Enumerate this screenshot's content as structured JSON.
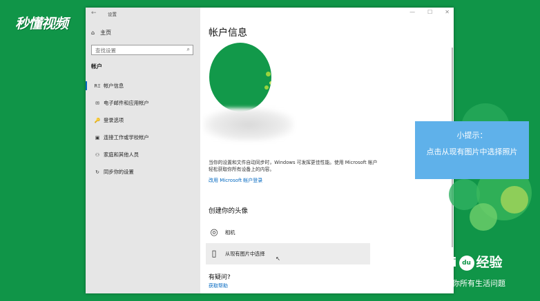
{
  "watermark": {
    "logo_text": "秒懂视频"
  },
  "window": {
    "title": "设置",
    "back_glyph": "←",
    "controls": [
      "—",
      "☐",
      "✕"
    ]
  },
  "sidebar": {
    "home_icon": "⌂",
    "home_label": "主页",
    "search_placeholder": "查找设置",
    "search_icon": "⌕",
    "section": "帐户",
    "items": [
      {
        "icon": "RΞ",
        "label": "帐户信息",
        "active": true
      },
      {
        "icon": "✉",
        "label": "电子邮件和应用帐户"
      },
      {
        "icon": "🔑",
        "label": "登录选项"
      },
      {
        "icon": "▣",
        "label": "连接工作或学校帐户"
      },
      {
        "icon": "⚇",
        "label": "家庭和其他人员"
      },
      {
        "icon": "↻",
        "label": "同步你的设置"
      }
    ]
  },
  "main": {
    "title": "帐户信息",
    "description": "当你的设置和文件自动同步时，Windows 可发挥更佳性能。使用 Microsoft 帐户轻松获取你所有设备上的内容。",
    "ms_link": "改用 Microsoft 帐户登录",
    "create_avatar_heading": "创建你的头像",
    "options": [
      {
        "icon": "◎",
        "label": "相机"
      },
      {
        "icon": "▯",
        "label": "从现有图片中选择"
      }
    ],
    "cursor_glyph": "↖",
    "questions_heading": "有疑问?",
    "help_link": "获取帮助"
  },
  "tip": {
    "title": "小提示：",
    "text": "点击从现有图片中选择照片"
  },
  "branding": {
    "baidu_left": "i",
    "baidu_paw": "du",
    "baidu_right": "经验",
    "slogan": "你所有生活问题"
  },
  "colors": {
    "background": "#109548",
    "accent": "#0067c0",
    "tip_bg": "#5fb1ea",
    "avatar": "#12994a"
  }
}
